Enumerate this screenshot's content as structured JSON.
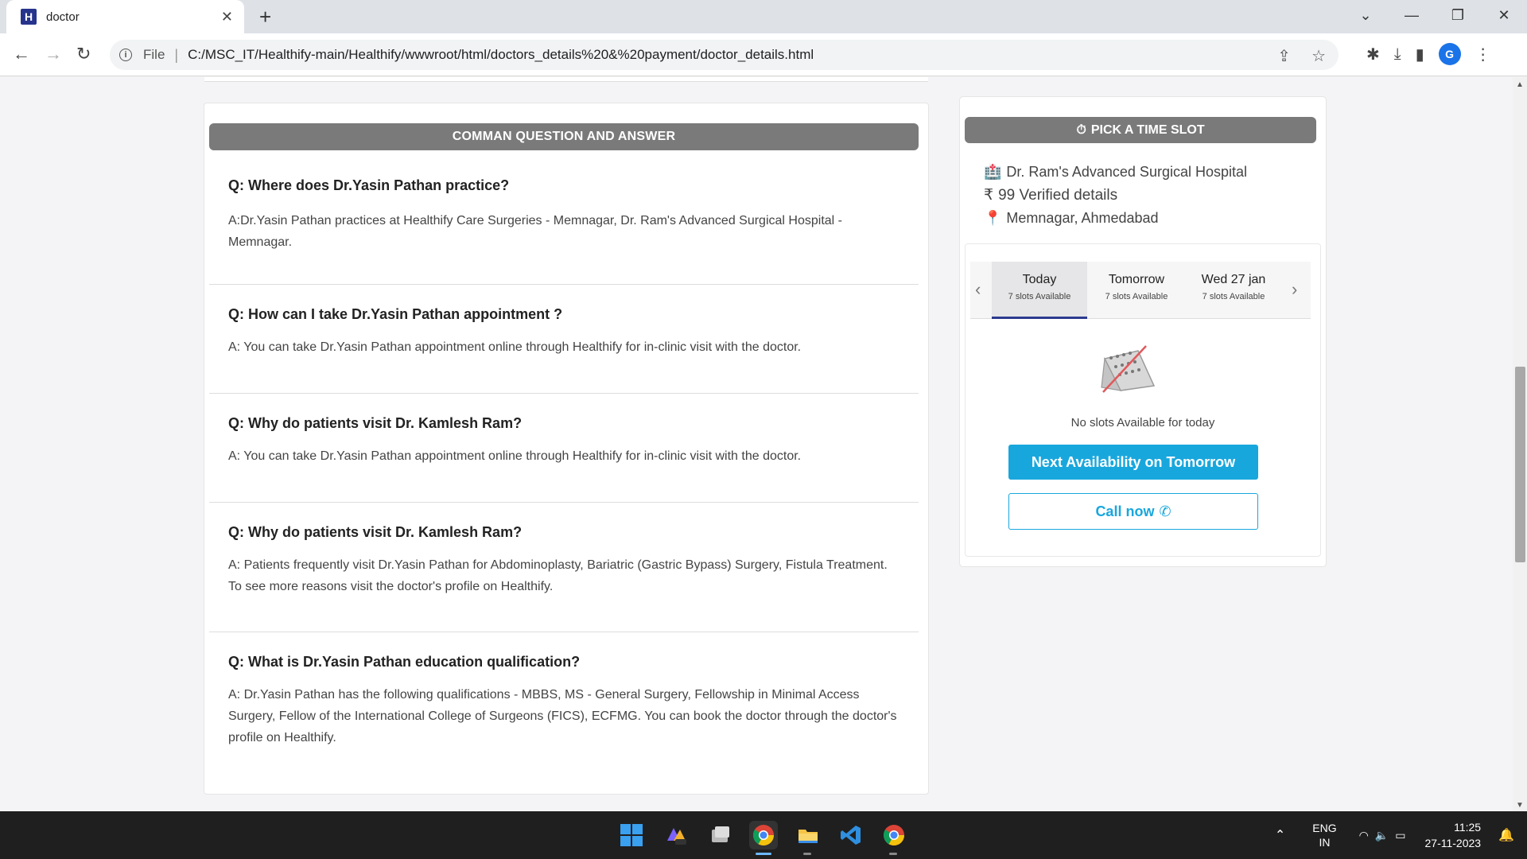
{
  "browser": {
    "tab_title": "doctor",
    "file_label": "File",
    "url": "C:/MSC_IT/Healthify-main/Healthify/wwwroot/html/doctors_details%20&%20payment/doctor_details.html",
    "avatar_letter": "G"
  },
  "faq": {
    "header": "COMMAN QUESTION AND ANSWER",
    "items": [
      {
        "q": "Q: Where does Dr.Yasin Pathan practice?",
        "a": "A:Dr.Yasin Pathan practices at Healthify Care Surgeries - Memnagar, Dr. Ram's Advanced Surgical Hospital - Memnagar."
      },
      {
        "q": "Q: How can I take Dr.Yasin Pathan appointment ?",
        "a": "A: You can take Dr.Yasin Pathan appointment online through Healthify for in-clinic visit with the doctor."
      },
      {
        "q": "Q: Why do patients visit Dr. Kamlesh Ram?",
        "a": "A: You can take Dr.Yasin Pathan appointment online through Healthify for in-clinic visit with the doctor."
      },
      {
        "q": "Q: Why do patients visit Dr. Kamlesh Ram?",
        "a": "A: Patients frequently visit Dr.Yasin Pathan for Abdominoplasty, Bariatric (Gastric Bypass) Surgery, Fistula Treatment. To see more reasons visit the doctor's profile on Healthify."
      },
      {
        "q": "Q: What is Dr.Yasin Pathan education qualification?",
        "a": "A: Dr.Yasin Pathan has the following qualifications - MBBS, MS - General Surgery, Fellowship in Minimal Access Surgery, Fellow of the International College of Surgeons (FICS), ECFMG. You can book the doctor through the doctor's profile on Healthify."
      }
    ]
  },
  "slots": {
    "header": "PICK A TIME SLOT",
    "hospital": "Dr. Ram's Advanced Surgical Hospital",
    "fee_symbol": "₹",
    "fee": "99 Verified details",
    "location": "Memnagar, Ahmedabad",
    "days": [
      {
        "name": "Today",
        "sub": "7 slots Available"
      },
      {
        "name": "Tomorrow",
        "sub": "7 slots Available"
      },
      {
        "name": "Wed 27 jan",
        "sub": "7 slots Available"
      }
    ],
    "no_slots_text": "No slots Available for today",
    "next_button": "Next Availability on Tomorrow",
    "call_button": "Call now"
  },
  "taskbar": {
    "lang_1": "ENG",
    "lang_2": "IN",
    "time": "11:25",
    "date": "27-11-2023"
  },
  "colors": {
    "accent": "#18a7dd",
    "header_gray": "#7a7a7a",
    "active_tab_underline": "#2b3a8f"
  }
}
